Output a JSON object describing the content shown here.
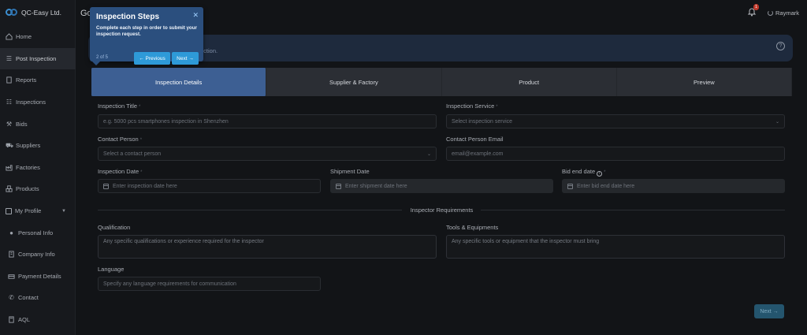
{
  "app": {
    "name": "QC-Easy Ltd."
  },
  "sidebar": {
    "items": [
      {
        "label": "Home",
        "icon": "home-icon"
      },
      {
        "label": "Post Inspection",
        "icon": "list-icon"
      },
      {
        "label": "Reports",
        "icon": "document-icon"
      },
      {
        "label": "Inspections",
        "icon": "list-icon"
      },
      {
        "label": "Bids",
        "icon": "gavel-icon"
      },
      {
        "label": "Suppliers",
        "icon": "truck-icon"
      },
      {
        "label": "Factories",
        "icon": "factory-icon"
      },
      {
        "label": "Products",
        "icon": "boxes-icon"
      },
      {
        "label": "My Profile",
        "icon": "profile-icon"
      },
      {
        "label": "Personal Info",
        "icon": "person-icon"
      },
      {
        "label": "Company Info",
        "icon": "building-icon"
      },
      {
        "label": "Payment Details",
        "icon": "payment-icon"
      },
      {
        "label": "Contact",
        "icon": "phone-icon"
      },
      {
        "label": "AQL",
        "icon": "calculator-icon"
      }
    ]
  },
  "topbar": {
    "heading": "Go",
    "notification_count": "1",
    "user_name": "Raymark"
  },
  "banner": {
    "text": "ection."
  },
  "steps": [
    "Inspection Details",
    "Supplier & Factory",
    "Product",
    "Preview"
  ],
  "form": {
    "inspection_title": {
      "label": "Inspection Title",
      "placeholder": "e.g. 5000 pcs smartphones inspection in Shenzhen"
    },
    "inspection_service": {
      "label": "Inspection Service",
      "placeholder": "Select inspection service"
    },
    "contact_person": {
      "label": "Contact Person",
      "placeholder": "Select a contact person"
    },
    "contact_email": {
      "label": "Contact Person Email",
      "placeholder": "email@example.com"
    },
    "inspection_date": {
      "label": "Inspection Date",
      "placeholder": "Enter inspection date here"
    },
    "shipment_date": {
      "label": "Shipment Date",
      "placeholder": "Enter shipment date here"
    },
    "bid_end_date": {
      "label": "Bid end date",
      "placeholder": "Enter bid end date here"
    },
    "section_title": "Inspector Requirements",
    "qualification": {
      "label": "Qualification",
      "placeholder": "Any specific qualifications or experience required for the inspector"
    },
    "tools": {
      "label": "Tools & Equipments",
      "placeholder": "Any specific tools or equipment that the inspector must bring"
    },
    "language": {
      "label": "Language",
      "placeholder": "Specify any language requirements for communication"
    },
    "next_label": "Next →"
  },
  "tour": {
    "title": "Inspection Steps",
    "text": "Complete each step in order to submit your inspection request.",
    "progress": "2 of 5",
    "previous_label": "← Previous",
    "next_label": "Next →"
  }
}
